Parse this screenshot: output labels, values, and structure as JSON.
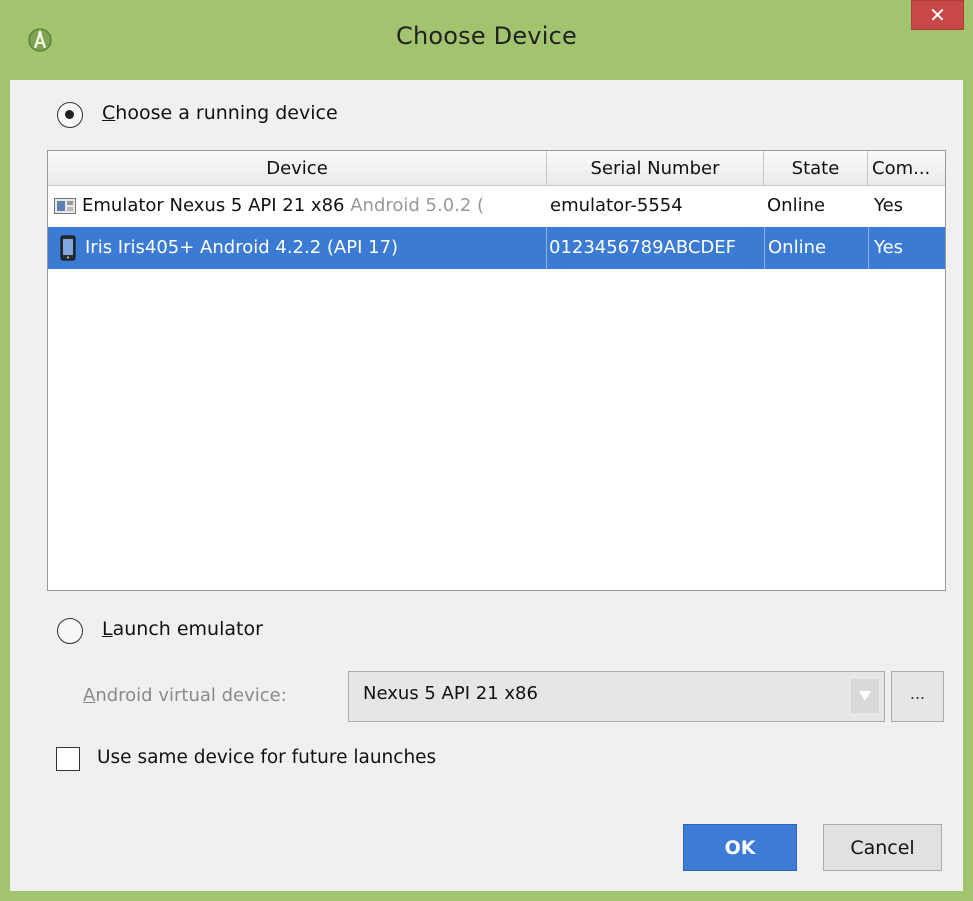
{
  "window": {
    "title": "Choose Device",
    "close_glyph": "✕",
    "icon": "android-studio-icon"
  },
  "choose_running": {
    "label": "Choose a running device",
    "selected": true
  },
  "device_table": {
    "columns": [
      "Device",
      "Serial Number",
      "State",
      "Com..."
    ],
    "rows": [
      {
        "icon": "emulator-icon",
        "device_name": "Emulator Nexus 5 API 21 x86",
        "device_detail": "Android 5.0.2 (",
        "serial": "emulator-5554",
        "state": "Online",
        "compatible": "Yes",
        "selected": false
      },
      {
        "icon": "phone-icon",
        "device_name": "Iris Iris405+ Android 4.2.2 (API 17)",
        "device_detail": "",
        "serial": "0123456789ABCDEF",
        "state": "Online",
        "compatible": "Yes",
        "selected": true
      }
    ]
  },
  "launch_emulator": {
    "label": "Launch emulator",
    "selected": false
  },
  "avd": {
    "label": "Android virtual device:",
    "value": "Nexus 5 API 21 x86",
    "more_label": "..."
  },
  "same_device": {
    "label": "Use same device for future launches",
    "checked": false
  },
  "buttons": {
    "ok": "OK",
    "cancel": "Cancel"
  },
  "colors": {
    "frame": "#a3c46e",
    "selection": "#3b7bd4",
    "close": "#c74846"
  }
}
